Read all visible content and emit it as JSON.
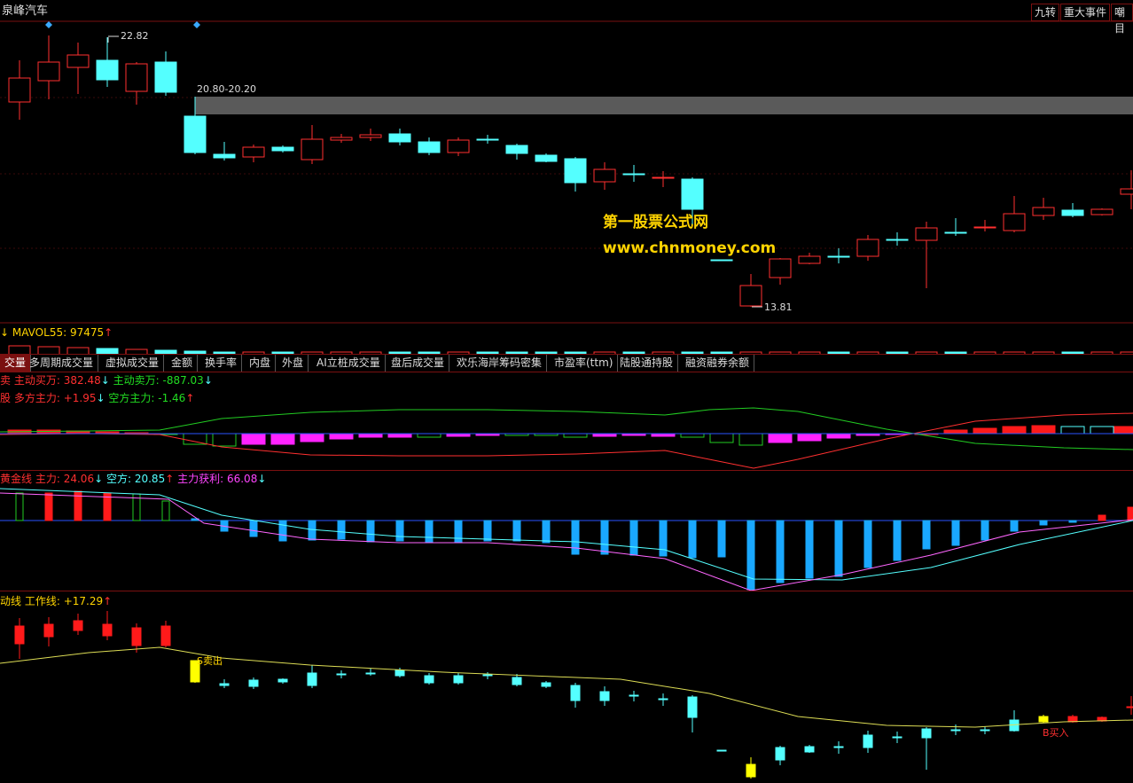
{
  "header": {
    "stock_name": "泉峰汽车",
    "buttons": [
      "九转",
      "重大事件",
      "嘲目"
    ]
  },
  "price_chart": {
    "high_label": "22.82",
    "low_label": "13.81",
    "gap_label": "20.80-20.20"
  },
  "watermark": {
    "line1": "第一股票公式网",
    "line2": "www.chnmoney.com"
  },
  "volume_panel": {
    "prefix": "↓",
    "label": "MAVOL55:",
    "value": "97475",
    "arrow": "↑"
  },
  "tabs": [
    "交量",
    "多周期成交量",
    "虚拟成交量",
    "金额",
    "换手率",
    "内盘",
    "外盘",
    "AI立桩成交量",
    "盘后成交量",
    "欢乐海岸筹码密集",
    "市盈率(ttm)",
    "陆股通持股",
    "融资融券余额"
  ],
  "indicator1": {
    "prefix": "卖",
    "buy_label": "主动买万:",
    "buy_value": "382.48",
    "buy_arrow": "↓",
    "sell_label": "主动卖万:",
    "sell_value": "-887.03",
    "sell_arrow": "↓"
  },
  "indicator2": {
    "prefix": "股",
    "long_label": "多方主力:",
    "long_value": "+1.95",
    "long_arrow": "↓",
    "short_label": "空方主力:",
    "short_value": "-1.46",
    "short_arrow": "↑"
  },
  "indicator3": {
    "prefix": "黄金线",
    "main_label": "主力:",
    "main_value": "24.06",
    "main_arrow": "↓",
    "bear_label": "空方:",
    "bear_value": "20.85",
    "bear_arrow": "↑",
    "profit_label": "主力获利:",
    "profit_value": "66.08",
    "profit_arrow": "↓"
  },
  "indicator4": {
    "prefix": "动线",
    "work_label": "工作线:",
    "work_value": "+17.29",
    "work_arrow": "↑",
    "sell_signal": "S卖出",
    "buy_signal": "B买入"
  },
  "colors": {
    "up": "#ff3030",
    "down": "#54ffff",
    "panel_border": "#7a1010",
    "yellow": "#ffd400"
  }
}
